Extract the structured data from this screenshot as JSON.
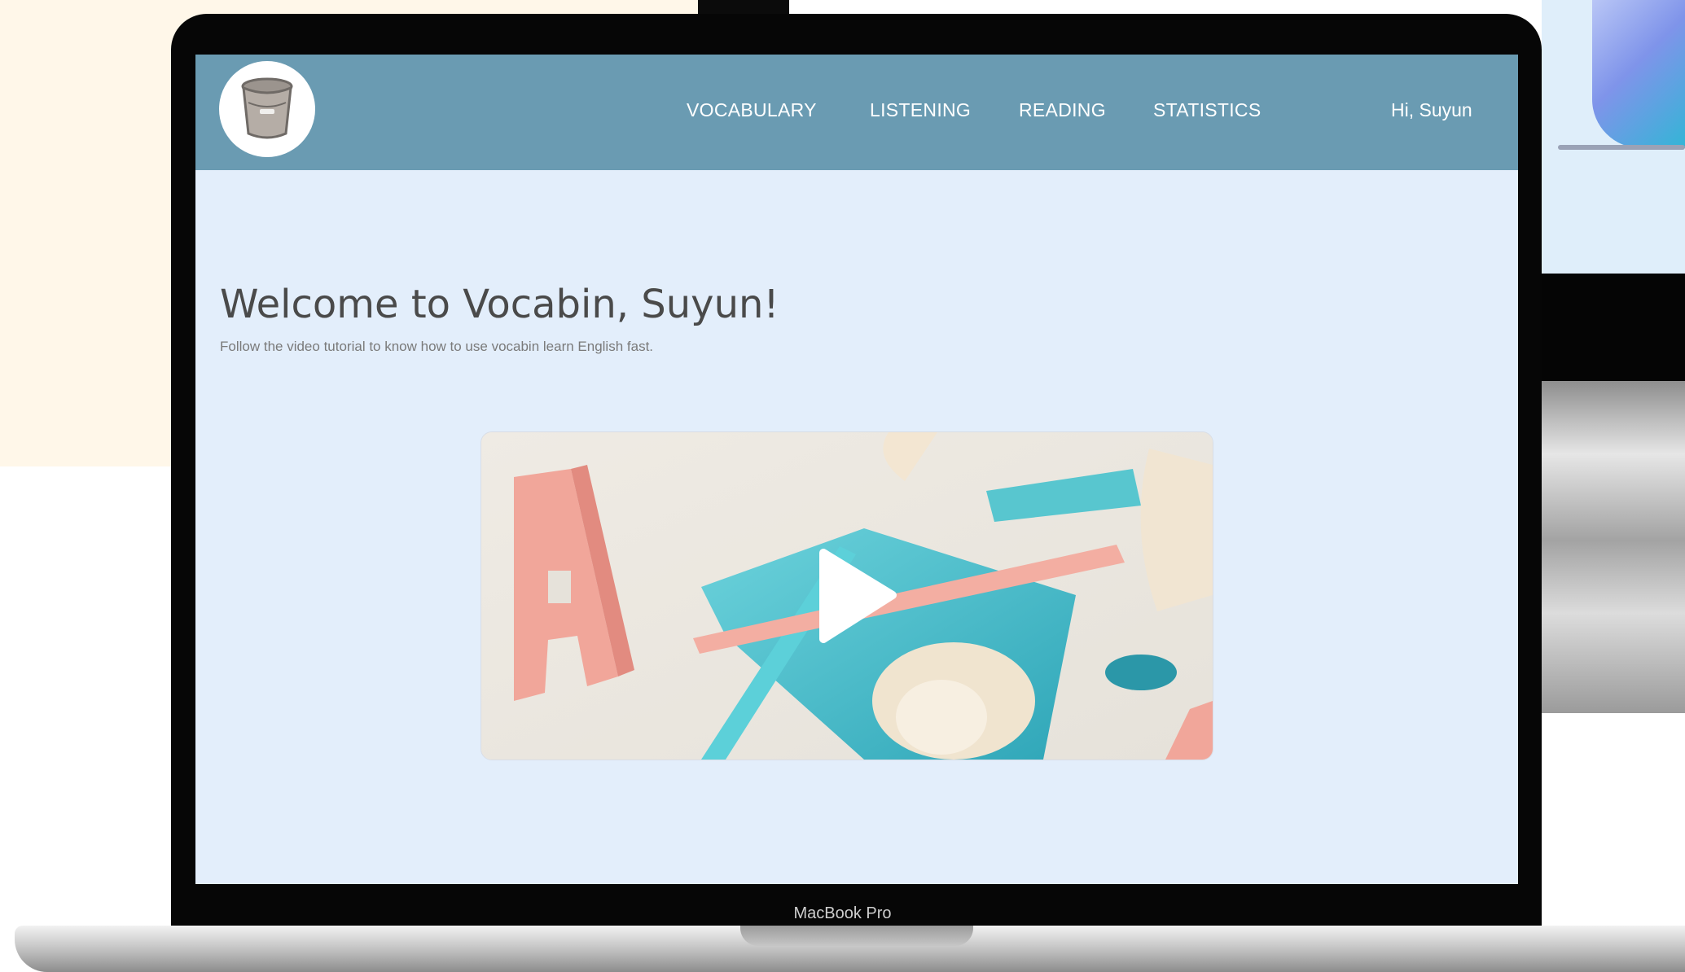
{
  "colors": {
    "header_bg": "#6a9bb2",
    "screen_bg": "#e3eefb",
    "accent_teal": "#49c3cf",
    "accent_pink": "#f1a69a"
  },
  "header": {
    "logo_icon": "trash-bin-icon",
    "nav": [
      {
        "label": "VOCABULARY"
      },
      {
        "label": "LISTENING"
      },
      {
        "label": "READING"
      },
      {
        "label": "STATISTICS"
      }
    ],
    "greeting": "Hi, Suyun"
  },
  "main": {
    "title": "Welcome to Vocabin, Suyun!",
    "subtitle": "Follow the video tutorial to know how to use vocabin learn English fast.",
    "video": {
      "play_icon": "play-icon"
    }
  },
  "device": {
    "label": "MacBook Pro"
  }
}
